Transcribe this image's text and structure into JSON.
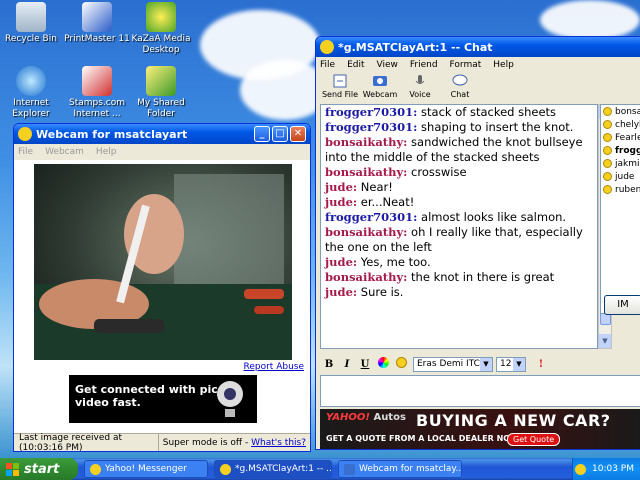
{
  "desktop": {
    "icons": [
      {
        "label": "Recycle Bin"
      },
      {
        "label": "PrintMaster 11"
      },
      {
        "label": "KaZaA Media Desktop"
      },
      {
        "label": "Internet Explorer"
      },
      {
        "label": "Stamps.com Internet ..."
      },
      {
        "label": "My Shared Folder"
      }
    ]
  },
  "webcam_window": {
    "title": "Webcam for msatclayart",
    "menu": [
      "File",
      "Webcam",
      "Help"
    ],
    "report_link": "Report Abuse",
    "ad_text": "Get connected with pics or video fast.",
    "status_left": "Last image received at (10:03:16 PM)",
    "status_mode": "Super mode is off -",
    "status_link": "What's this?"
  },
  "chat_window": {
    "title": "*g.MSATClayArt:1  -- Chat",
    "menu": [
      "File",
      "Edit",
      "View",
      "Friend",
      "Format",
      "Help"
    ],
    "toolbar": [
      "Send File",
      "Webcam",
      "Voice",
      "Chat"
    ],
    "messages": [
      {
        "nick": "frogger70301:",
        "text": " stack of stacked sheets",
        "color": "#1a1aa6"
      },
      {
        "nick": "frogger70301:",
        "text": " shaping to insert the knot.",
        "color": "#1a1aa6"
      },
      {
        "nick": "bonsaikathy:",
        "text": " sandwiched the knot bullseye into the middle of the stacked sheets",
        "color": "#a61a4a"
      },
      {
        "nick": "bonsaikathy:",
        "text": " crosswise",
        "color": "#a61a4a"
      },
      {
        "nick": "jude:",
        "text": " Near!",
        "color": "#a61a4a"
      },
      {
        "nick": "jude:",
        "text": " er...Neat!",
        "color": "#a61a4a"
      },
      {
        "nick": "frogger70301:",
        "text": " almost looks like salmon.",
        "color": "#1a1aa6"
      },
      {
        "nick": "bonsaikathy:",
        "text": " oh I really like that, especially the one on the left",
        "color": "#a61a4a"
      },
      {
        "nick": "jude:",
        "text": " Yes, me too.",
        "color": "#a61a4a"
      },
      {
        "nick": "bonsaikathy:",
        "text": " the knot in there is great",
        "color": "#a61a4a"
      },
      {
        "nick": "jude:",
        "text": " Sure is.",
        "color": "#a61a4a"
      }
    ],
    "users": [
      {
        "name": "bonsa",
        "bold": false
      },
      {
        "name": "chelyh",
        "bold": false
      },
      {
        "name": "Fearle",
        "bold": false
      },
      {
        "name": "frogg",
        "bold": true
      },
      {
        "name": "jakmia",
        "bold": false
      },
      {
        "name": "jude",
        "bold": false
      },
      {
        "name": "rubens",
        "bold": false
      }
    ],
    "im_button": "IM",
    "format": {
      "bold": "B",
      "italic": "I",
      "underline": "U",
      "font": "Eras Demi ITC",
      "size": "12"
    },
    "ad": {
      "brand": "YAHOO!",
      "brand2": "Autos",
      "headline": "BUYING A NEW CAR?",
      "sub": "GET A QUOTE FROM A LOCAL DEALER NOW.",
      "button": "Get Quote"
    }
  },
  "taskbar": {
    "start_label": "start",
    "tasks": [
      {
        "label": "Yahoo! Messenger"
      },
      {
        "label": "*g.MSATClayArt:1 -- ..."
      },
      {
        "label": "Webcam for msatclay..."
      }
    ],
    "clock": "10:03 PM"
  }
}
